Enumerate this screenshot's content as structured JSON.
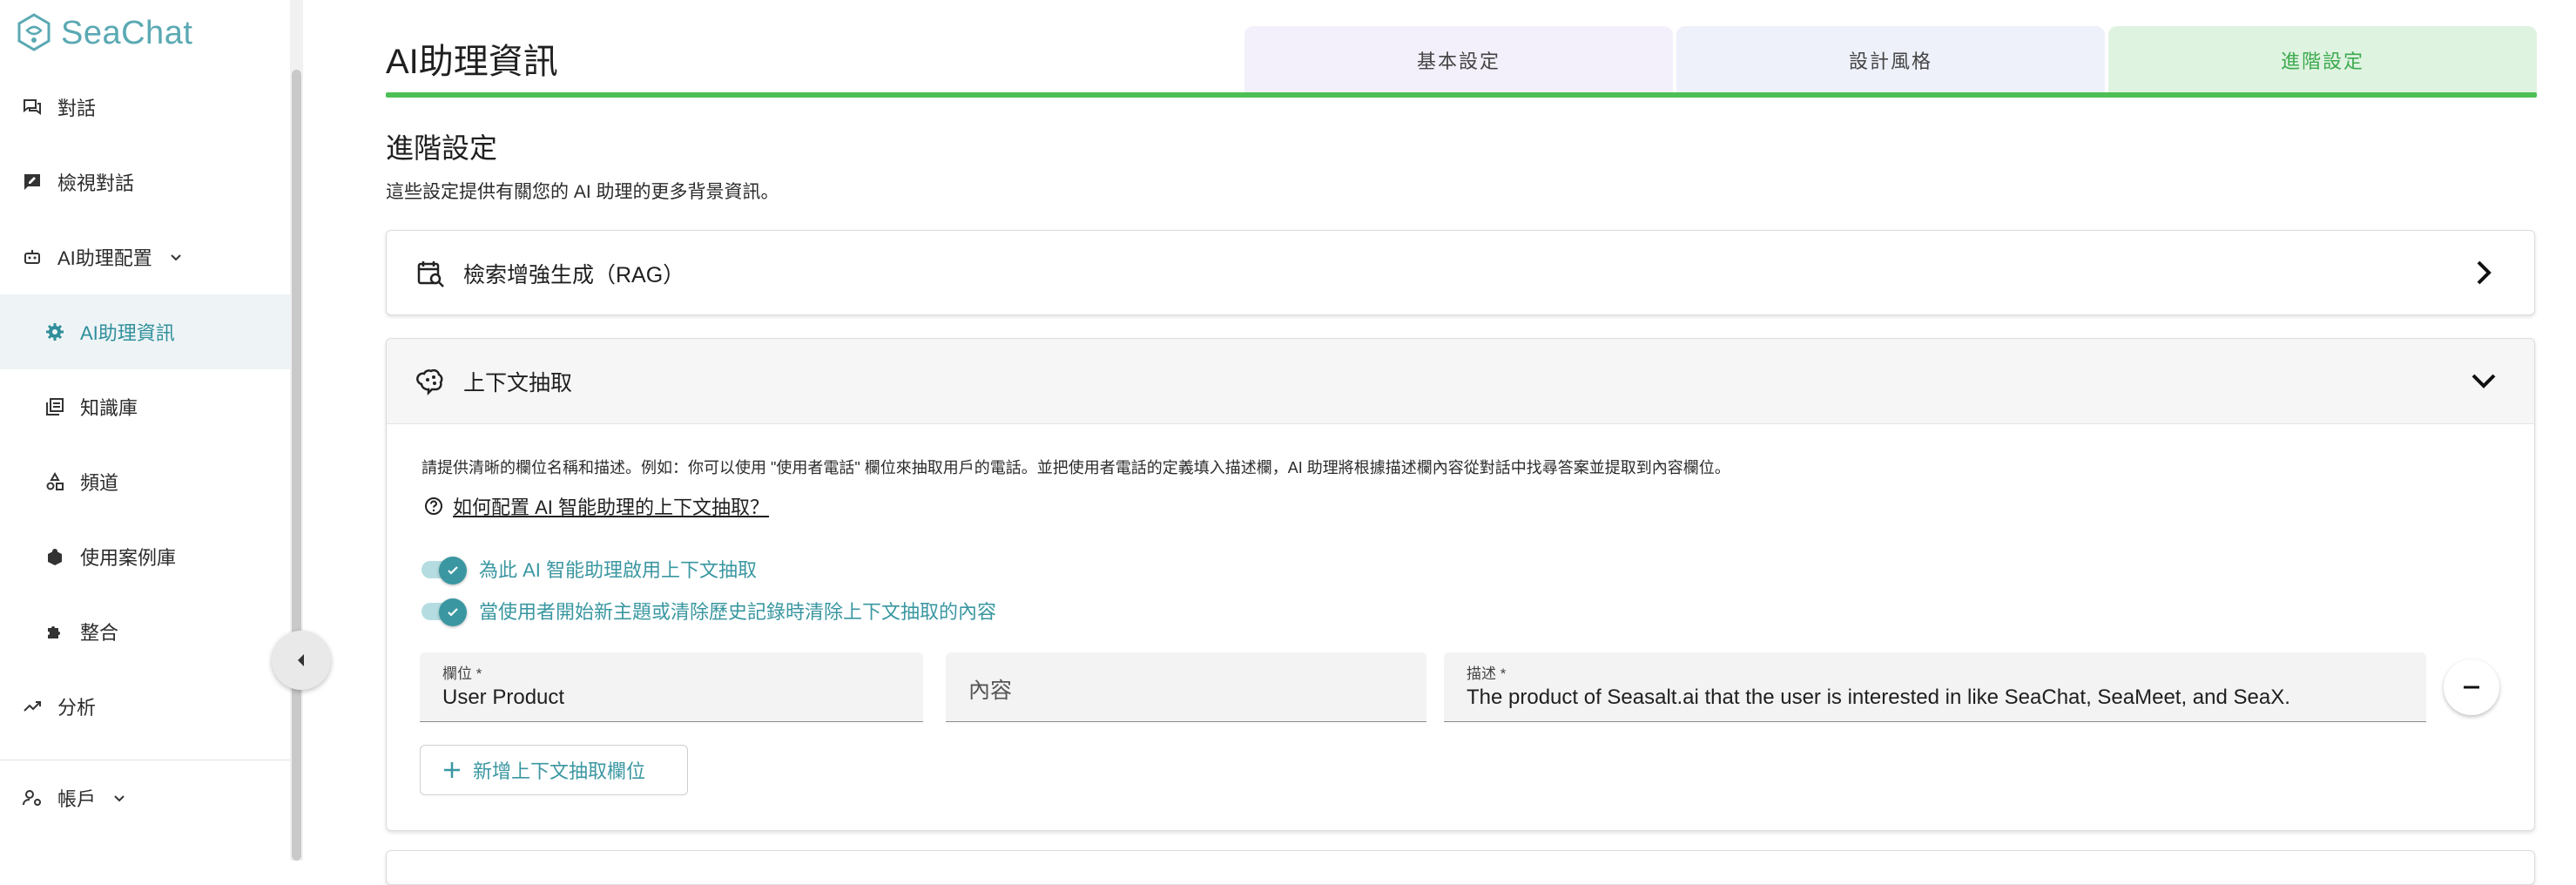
{
  "app": {
    "logo_text": "SeaChat"
  },
  "sidebar": {
    "items": [
      {
        "label": "對話",
        "icon": "chat-icon"
      },
      {
        "label": "檢視對話",
        "icon": "review-chat-icon"
      },
      {
        "label": "AI助理配置",
        "icon": "robot-icon"
      },
      {
        "label": "AI助理資訊",
        "icon": "gear-icon"
      },
      {
        "label": "知識庫",
        "icon": "library-icon"
      },
      {
        "label": "頻道",
        "icon": "shapes-icon"
      },
      {
        "label": "使用案例庫",
        "icon": "box-icon"
      },
      {
        "label": "整合",
        "icon": "puzzle-icon"
      },
      {
        "label": "分析",
        "icon": "trend-icon"
      },
      {
        "label": "帳戶",
        "icon": "user-settings-icon"
      }
    ]
  },
  "header": {
    "title": "AI助理資訊",
    "tabs": [
      {
        "label": "基本設定"
      },
      {
        "label": "設計風格"
      },
      {
        "label": "進階設定"
      }
    ]
  },
  "section": {
    "title": "進階設定",
    "description": "這些設定提供有關您的 AI 助理的更多背景資訊。"
  },
  "rag": {
    "title": "檢索增強生成（RAG）"
  },
  "context": {
    "title": "上下文抽取",
    "description": "請提供清晰的欄位名稱和描述。例如：你可以使用 \"使用者電話\" 欄位來抽取用戶的電話。並把使用者電話的定義填入描述欄，AI 助理將根據描述欄內容從對話中找尋答案並提取到內容欄位。",
    "help_link": "如何配置 AI 智能助理的上下文抽取？",
    "toggle1": "為此 AI 智能助理啟用上下文抽取",
    "toggle2": "當使用者開始新主題或清除歷史記錄時清除上下文抽取的內容",
    "field_label": "欄位",
    "field_value": "User Product",
    "content_placeholder": "內容",
    "desc_label": "描述",
    "desc_value": "The product of Seasalt.ai that the user is interested in like SeaChat, SeaMeet, and SeaX.",
    "add_button": "新增上下文抽取欄位"
  },
  "colors": {
    "accent": "#3a97a1",
    "tab_active": "#3eaa4f",
    "tab_line": "#4cbf55"
  }
}
